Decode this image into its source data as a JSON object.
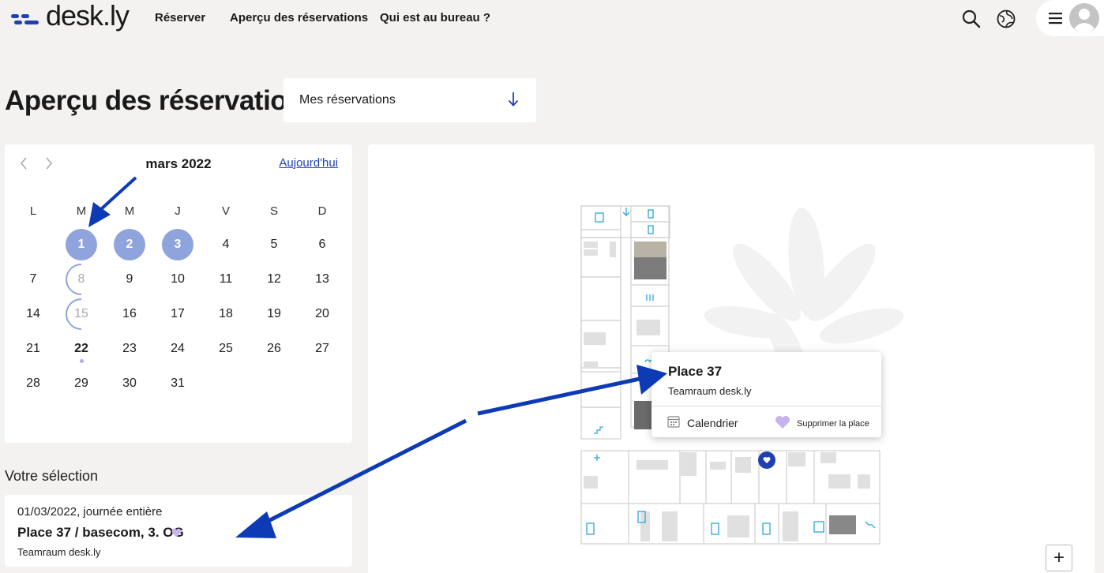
{
  "brand": {
    "name": "desk.ly",
    "accent": "#1f3fb3"
  },
  "nav": {
    "items": [
      {
        "label": "Réserver"
      },
      {
        "label": "Aperçu des réservations"
      },
      {
        "label": "Qui est au bureau ?"
      }
    ]
  },
  "toolbar": {
    "icons": [
      "search-icon",
      "globe-icon",
      "menu-icon",
      "avatar-icon"
    ]
  },
  "page": {
    "title": "Aperçu des réservations",
    "filter": {
      "value": "Mes réservations",
      "icon": "arrow-down-icon"
    }
  },
  "calendar": {
    "month": "mars 2022",
    "today_label": "Aujourd'hui",
    "weekdays": [
      "L",
      "M",
      "M",
      "J",
      "V",
      "S",
      "D"
    ],
    "weeks": [
      [
        "",
        "1",
        "2",
        "3",
        "4",
        "5",
        "6"
      ],
      [
        "7",
        "8",
        "9",
        "10",
        "11",
        "12",
        "13"
      ],
      [
        "14",
        "15",
        "16",
        "17",
        "18",
        "19",
        "20"
      ],
      [
        "21",
        "22",
        "23",
        "24",
        "25",
        "26",
        "27"
      ],
      [
        "28",
        "29",
        "30",
        "31",
        "",
        "",
        ""
      ]
    ],
    "booked_days": [
      "1",
      "2",
      "3"
    ],
    "partial_days": [
      "8",
      "15"
    ],
    "today": "22",
    "booked_color": "#8fa3dd"
  },
  "selection": {
    "heading": "Votre sélection",
    "date": "01/03/2022, journée entière",
    "place": "Place 37 / basecom, 3. OG",
    "room": "Teamraum desk.ly"
  },
  "popup": {
    "title": "Place 37",
    "subtitle": "Teamraum desk.ly",
    "calendar_label": "Calendrier",
    "remove_label": "Supprimer la place"
  },
  "map": {
    "zoom_in_label": "+"
  },
  "colors": {
    "background": "#f4f2f0",
    "heart": "#c6b3ef",
    "plan_icon": "#2aa8d8",
    "annotation_arrow": "#0d3bb5"
  }
}
